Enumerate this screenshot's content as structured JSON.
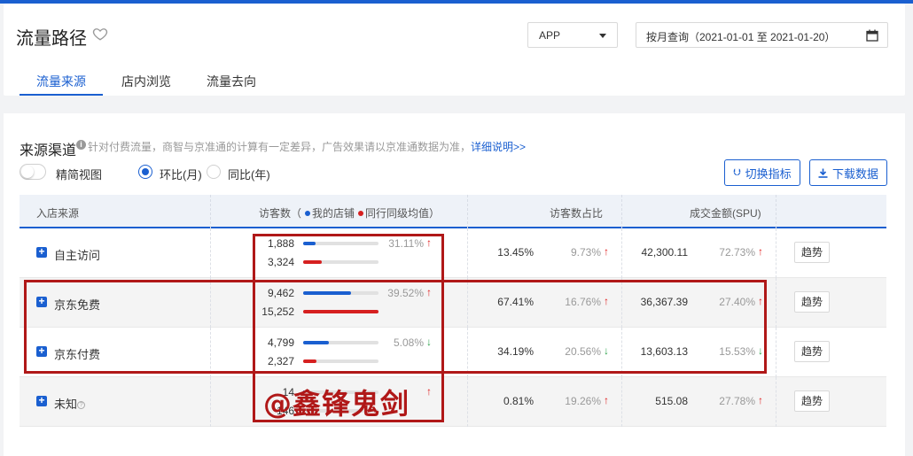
{
  "header": {
    "title": "流量路径",
    "platform_select": "APP",
    "date_range": "按月查询（2021-01-01 至 2021-01-20）",
    "tabs": [
      "流量来源",
      "店内浏览",
      "流量去向"
    ]
  },
  "section": {
    "title": "来源渠道",
    "note": "针对付费流量，商智与京准通的计算有一定差异，广告效果请以京准通数据为准，",
    "note_link": "详细说明>>",
    "toggle_label": "精简视图",
    "radio_mom": "环比(月)",
    "radio_yoy": "同比(年)",
    "btn_switch": "切换指标",
    "btn_download": "下载数据"
  },
  "table": {
    "headers": {
      "source": "入店来源",
      "visitors": "访客数（",
      "my_store": "我的店铺",
      "peer_avg": "同行同级均值",
      "visitors_close": "）",
      "visitor_share": "访客数占比",
      "gmv": "成交金额(SPU)"
    },
    "trend_label": "趋势",
    "rows": [
      {
        "name": "自主访问",
        "mine": "1,888",
        "peer": "3,324",
        "mine_ratio": 0.16,
        "peer_ratio": 0.25,
        "change": "31.11%",
        "change_dir": "up",
        "share": "13.45%",
        "share_change": "9.73%",
        "share_dir": "up",
        "gmv": "42,300.11",
        "gmv_change": "72.73%",
        "gmv_dir": "up"
      },
      {
        "name": "京东免费",
        "mine": "9,462",
        "peer": "15,252",
        "mine_ratio": 0.64,
        "peer_ratio": 1.0,
        "change": "39.52%",
        "change_dir": "up",
        "share": "67.41%",
        "share_change": "16.76%",
        "share_dir": "up",
        "gmv": "36,367.39",
        "gmv_change": "27.40%",
        "gmv_dir": "up"
      },
      {
        "name": "京东付费",
        "mine": "4,799",
        "peer": "2,327",
        "mine_ratio": 0.34,
        "peer_ratio": 0.18,
        "change": "5.08%",
        "change_dir": "down",
        "share": "34.19%",
        "share_change": "20.56%",
        "share_dir": "down",
        "gmv": "13,603.13",
        "gmv_change": "15.53%",
        "gmv_dir": "down"
      },
      {
        "name": "未知",
        "mine": "14",
        "peer": "146",
        "mine_ratio": 0.01,
        "peer_ratio": 0.02,
        "change": "",
        "change_dir": "up",
        "share": "0.81%",
        "share_change": "19.26%",
        "share_dir": "up",
        "gmv": "515.08",
        "gmv_change": "27.78%",
        "gmv_dir": "up"
      }
    ]
  },
  "watermark": "@鑫锋鬼剑",
  "colors": {
    "accent": "#1a5fd0",
    "peer": "#d62020",
    "annotation": "#b01818"
  }
}
